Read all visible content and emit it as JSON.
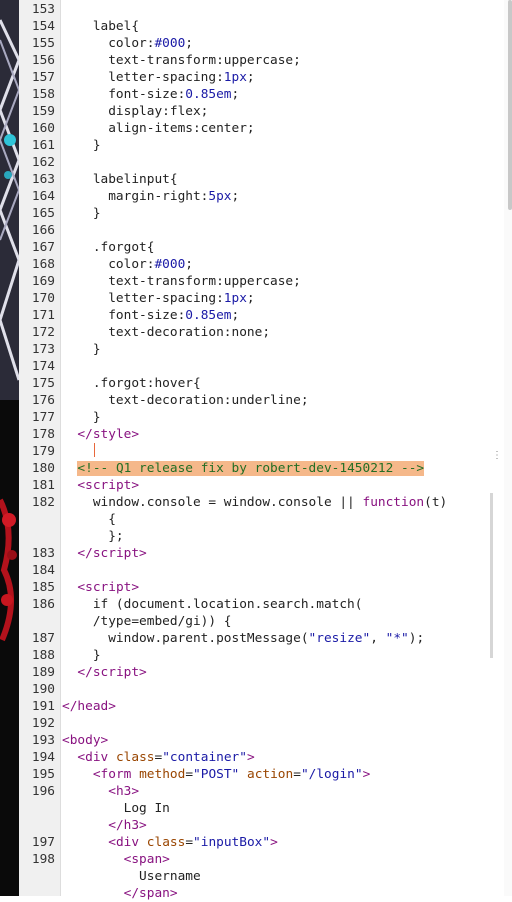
{
  "editor": {
    "lines": [
      {
        "n": "153",
        "html": ""
      },
      {
        "n": "154",
        "html": "    label{"
      },
      {
        "n": "155",
        "html": "      color:<span class='val'>#000</span>;"
      },
      {
        "n": "156",
        "html": "      text-transform:uppercase;"
      },
      {
        "n": "157",
        "html": "      letter-spacing:<span class='val'>1px</span>;"
      },
      {
        "n": "158",
        "html": "      font-size:<span class='val'>0.85em</span>;"
      },
      {
        "n": "159",
        "html": "      display:flex;"
      },
      {
        "n": "160",
        "html": "      align-items:center;"
      },
      {
        "n": "161",
        "html": "    }"
      },
      {
        "n": "162",
        "html": ""
      },
      {
        "n": "163",
        "html": "    labelinput{"
      },
      {
        "n": "164",
        "html": "      margin-right:<span class='val'>5px</span>;"
      },
      {
        "n": "165",
        "html": "    }"
      },
      {
        "n": "166",
        "html": ""
      },
      {
        "n": "167",
        "html": "    .forgot{"
      },
      {
        "n": "168",
        "html": "      color:<span class='val'>#000</span>;"
      },
      {
        "n": "169",
        "html": "      text-transform:uppercase;"
      },
      {
        "n": "170",
        "html": "      letter-spacing:<span class='val'>1px</span>;"
      },
      {
        "n": "171",
        "html": "      font-size:<span class='val'>0.85em</span>;"
      },
      {
        "n": "172",
        "html": "      text-decoration:none;"
      },
      {
        "n": "173",
        "html": "    }"
      },
      {
        "n": "174",
        "html": ""
      },
      {
        "n": "175",
        "html": "    .forgot:hover{"
      },
      {
        "n": "176",
        "html": "      text-decoration:underline;"
      },
      {
        "n": "177",
        "html": "    }"
      },
      {
        "n": "178",
        "html": "  <span class='tag'>&lt;/style&gt;</span>"
      },
      {
        "n": "179",
        "html": ""
      },
      {
        "n": "180",
        "html": "  <span class='comment-hl'>&lt;!-- Q1 release fix by robert-dev-1450212 --&gt;</span>"
      },
      {
        "n": "181",
        "html": "  <span class='tag'>&lt;script&gt;</span>"
      },
      {
        "n": "182",
        "html": "    window.console = window.console || <span class='kw'>function</span>(t)"
      },
      {
        "n": "",
        "html": "      {"
      },
      {
        "n": "",
        "html": "      };"
      },
      {
        "n": "183",
        "html": "  <span class='tag'>&lt;/script&gt;</span>"
      },
      {
        "n": "184",
        "html": ""
      },
      {
        "n": "185",
        "html": "  <span class='tag'>&lt;script&gt;</span>"
      },
      {
        "n": "186",
        "html": "    if (document.location.search.match("
      },
      {
        "n": "",
        "html": "    /type=embed/gi)) {"
      },
      {
        "n": "187",
        "html": "      window.parent.postMessage(<span class='str'>\"resize\"</span>, <span class='str'>\"*\"</span>);"
      },
      {
        "n": "188",
        "html": "    }"
      },
      {
        "n": "189",
        "html": "  <span class='tag'>&lt;/script&gt;</span>"
      },
      {
        "n": "190",
        "html": ""
      },
      {
        "n": "191",
        "html": "<span class='tag'>&lt;/head&gt;</span>"
      },
      {
        "n": "192",
        "html": ""
      },
      {
        "n": "193",
        "html": "<span class='tag'>&lt;body&gt;</span>"
      },
      {
        "n": "194",
        "html": "  <span class='tag'>&lt;div</span> <span class='attr'>class</span>=<span class='str'>\"container\"</span><span class='tag'>&gt;</span>"
      },
      {
        "n": "195",
        "html": "    <span class='tag'>&lt;form</span> <span class='attr'>method</span>=<span class='str'>\"POST\"</span> <span class='attr'>action</span>=<span class='str'>\"/login\"</span><span class='tag'>&gt;</span>"
      },
      {
        "n": "196",
        "html": "      <span class='tag'>&lt;h3&gt;</span>"
      },
      {
        "n": "",
        "html": "        Log In"
      },
      {
        "n": "",
        "html": "      <span class='tag'>&lt;/h3&gt;</span>"
      },
      {
        "n": "197",
        "html": "      <span class='tag'>&lt;div</span> <span class='attr'>class</span>=<span class='str'>\"inputBox\"</span><span class='tag'>&gt;</span>"
      },
      {
        "n": "198",
        "html": "        <span class='tag'>&lt;span&gt;</span>"
      },
      {
        "n": "",
        "html": "          Username"
      },
      {
        "n": "",
        "html": "        <span class='tag'>&lt;/span&gt;</span>"
      }
    ]
  },
  "colors": {
    "comment_highlight": "#f5b88a",
    "cursor": "#e8683b"
  },
  "icons": {
    "drag_handle": "vertical-dots-icon"
  }
}
